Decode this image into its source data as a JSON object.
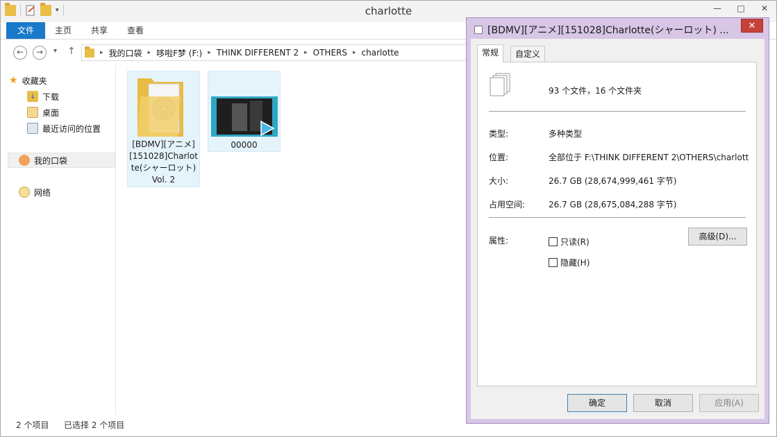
{
  "window": {
    "title": "charlotte",
    "controls": [
      "—",
      "□",
      "✕"
    ]
  },
  "ribbon": {
    "tabs": [
      "文件",
      "主页",
      "共享",
      "查看"
    ]
  },
  "address": {
    "crumbs": [
      "我的口袋",
      "哆啦F梦 (F:)",
      "THINK DIFFERENT 2",
      "OTHERS",
      "charlotte"
    ]
  },
  "nav": {
    "favorites": "收藏夹",
    "downloads": "下载",
    "desktop": "桌面",
    "recent": "最近访问的位置",
    "pocket": "我的口袋",
    "network": "网络"
  },
  "files": [
    {
      "label": "[BDMV][アニメ][151028]Charlotte(シャーロット) Vol. 2",
      "line1": "[BDMV][アニメ]",
      "line2": "[151028]Charlot",
      "line3": "te(シャーロット)",
      "line4": "Vol. 2"
    },
    {
      "label": "00000"
    }
  ],
  "status": {
    "count": "2 个项目",
    "selected": "已选择 2 个项目"
  },
  "dialog": {
    "title": "[BDMV][アニメ][151028]Charlotte(シャーロット) ...",
    "close": "✕",
    "tabs": [
      "常规",
      "自定义"
    ],
    "summary": "93 个文件，16 个文件夹",
    "type_label": "类型:",
    "type_value": "多种类型",
    "location_label": "位置:",
    "location_value": "全部位于 F:\\THINK DIFFERENT 2\\OTHERS\\charlott",
    "size_label": "大小:",
    "size_value": "26.7 GB (28,674,999,461 字节)",
    "disk_label": "占用空间:",
    "disk_value": "26.7 GB (28,675,084,288 字节)",
    "attr_label": "属性:",
    "readonly": "只读(R)",
    "hidden": "隐藏(H)",
    "advanced": "高级(D)...",
    "ok": "确定",
    "cancel": "取消",
    "apply": "应用(A)"
  }
}
